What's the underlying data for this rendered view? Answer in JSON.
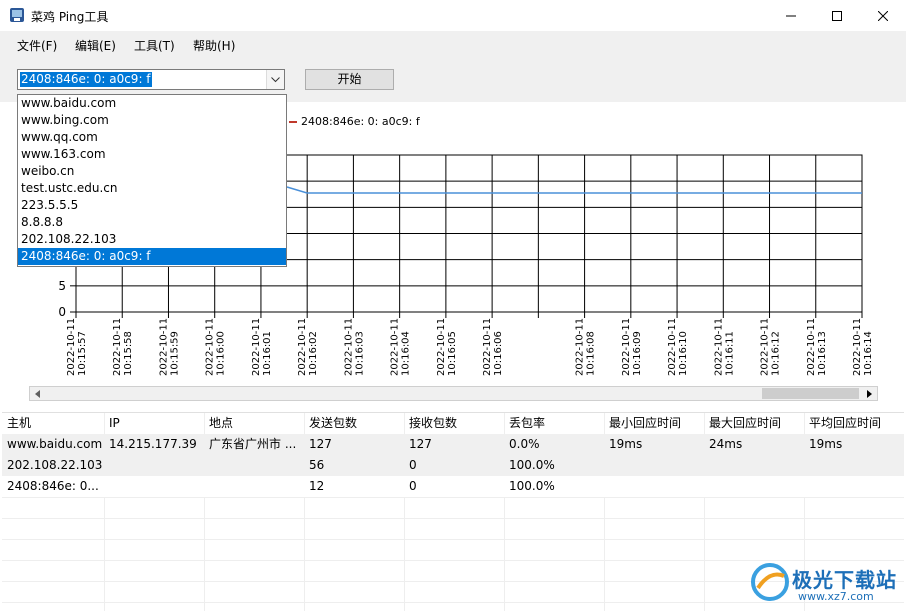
{
  "window": {
    "title": "菜鸡 Ping工具",
    "min_icon": "minimize-icon",
    "max_icon": "maximize-icon",
    "close_icon": "close-icon"
  },
  "menu": [
    {
      "label": "文件(F)"
    },
    {
      "label": "编辑(E)"
    },
    {
      "label": "工具(T)"
    },
    {
      "label": "帮助(H)"
    }
  ],
  "toolbar": {
    "host_value": "2408:846e: 0: a0c9: f",
    "start_label": "开始"
  },
  "dropdown": {
    "items": [
      "www.baidu.com",
      "www.bing.com",
      "www.qq.com",
      "www.163.com",
      "weibo.cn",
      "test.ustc.edu.cn",
      "223.5.5.5",
      "8.8.8.8",
      "202.108.22.103",
      "2408:846e: 0: a0c9: f"
    ],
    "selected_index": 9
  },
  "chart_data": {
    "type": "line",
    "legend": [
      "2408:846e: 0: a0c9: f"
    ],
    "series_color": "#4a90d9",
    "legend_color": "#c0392b",
    "y_ticks": [
      "0",
      "5"
    ],
    "x_ticks": [
      "2022-10-11 10:15:57",
      "2022-10-11 10:15:58",
      "2022-10-11 10:15:59",
      "2022-10-11 10:16:00",
      "2022-10-11 10:16:01",
      "2022-10-11 10:16:02",
      "2022-10-11 10:16:03",
      "2022-10-11 10:16:04",
      "2022-10-11 10:16:05",
      "2022-10-11 10:16:06",
      "",
      "2022-10-11 10:16:08",
      "2022-10-11 10:16:09",
      "2022-10-11 10:16:10",
      "2022-10-11 10:16:11",
      "2022-10-11 10:16:12",
      "2022-10-11 10:16:13",
      "2022-10-11 10:16:14"
    ],
    "grid": true
  },
  "table": {
    "headers": [
      "主机",
      "IP",
      "地点",
      "发送包数",
      "接收包数",
      "丢包率",
      "最小回应时间",
      "最大回应时间",
      "平均回应时间"
    ],
    "rows": [
      [
        "www.baidu.com",
        "14.215.177.39",
        "广东省广州市 ...",
        "127",
        "127",
        "0.0%",
        "19ms",
        "24ms",
        "19ms"
      ],
      [
        "202.108.22.103",
        "",
        "",
        "56",
        "0",
        "100.0%",
        "",
        "",
        ""
      ],
      [
        "2408:846e: 0...",
        "",
        "",
        "12",
        "0",
        "100.0%",
        "",
        "",
        ""
      ]
    ]
  },
  "watermark": {
    "text": "极光下载站",
    "url": "www.xz7.com"
  }
}
